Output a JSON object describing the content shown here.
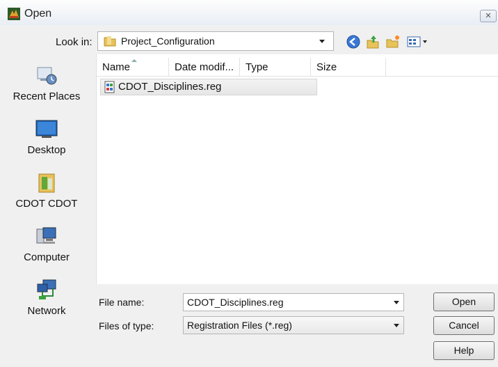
{
  "window": {
    "title": "Open",
    "close_glyph": "✕"
  },
  "toolbar": {
    "look_in_label": "Look in:",
    "look_in_value": "Project_Configuration",
    "buttons": [
      "back-icon",
      "up-folder-icon",
      "new-folder-icon",
      "views-menu-icon"
    ]
  },
  "places": [
    {
      "label": "Recent Places",
      "icon": "recent-places-icon"
    },
    {
      "label": "Desktop",
      "icon": "desktop-icon"
    },
    {
      "label": "CDOT CDOT",
      "icon": "user-folder-icon"
    },
    {
      "label": "Computer",
      "icon": "computer-icon"
    },
    {
      "label": "Network",
      "icon": "network-icon"
    }
  ],
  "file_list": {
    "columns": [
      "Name",
      "Date modif...",
      "Type",
      "Size"
    ],
    "files": [
      {
        "name": "CDOT_Disciplines.reg",
        "icon": "registry-file-icon"
      }
    ]
  },
  "form": {
    "file_name_label": "File name:",
    "file_name_value": "CDOT_Disciplines.reg",
    "file_type_label": "Files of type:",
    "file_type_value": "Registration Files (*.reg)"
  },
  "actions": {
    "open": "Open",
    "cancel": "Cancel",
    "help": "Help"
  }
}
